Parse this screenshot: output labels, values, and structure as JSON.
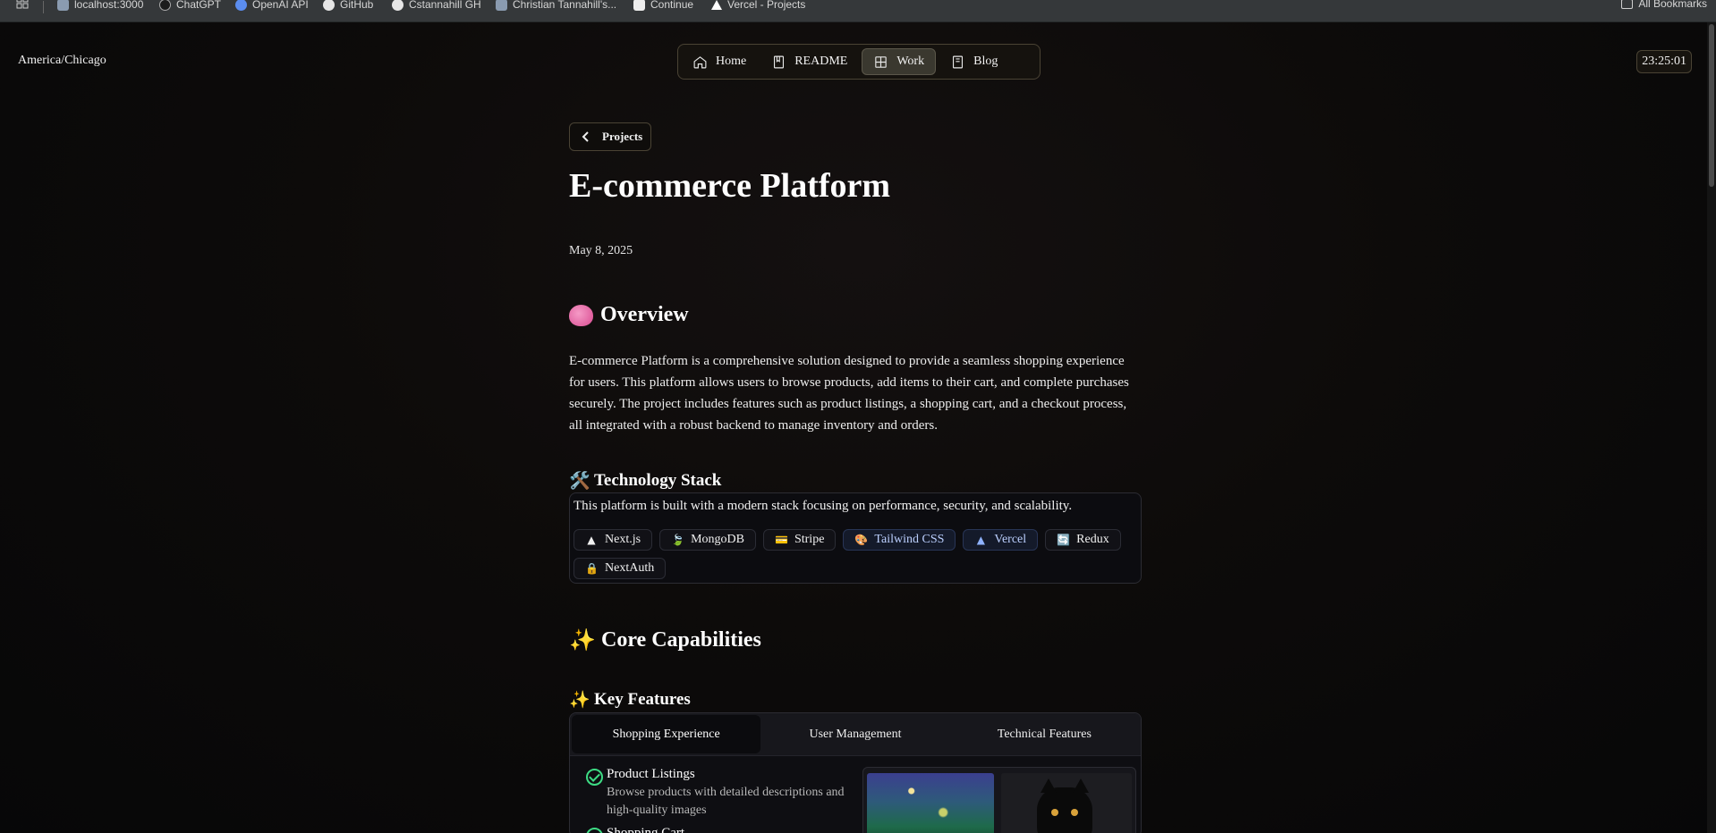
{
  "bookmarks": {
    "items": [
      {
        "label": "localhost:3000",
        "icon": "page-icon"
      },
      {
        "label": "ChatGPT",
        "icon": "openai-icon"
      },
      {
        "label": "OpenAI API",
        "icon": "openai-icon"
      },
      {
        "label": "GitHub",
        "icon": "github-icon"
      },
      {
        "label": "Cstannahill GH",
        "icon": "github-icon"
      },
      {
        "label": "Christian Tannahill's...",
        "icon": "page-icon"
      },
      {
        "label": "Continue",
        "icon": "continue-icon"
      },
      {
        "label": "Vercel - Projects",
        "icon": "vercel-icon"
      }
    ],
    "all_bookmarks": "All Bookmarks"
  },
  "header": {
    "timezone": "America/Chicago",
    "clock": "23:25:01",
    "nav": [
      {
        "label": "Home",
        "icon": "home-icon",
        "active": false
      },
      {
        "label": "README",
        "icon": "book-icon",
        "active": false
      },
      {
        "label": "Work",
        "icon": "grid-icon",
        "active": true
      },
      {
        "label": "Blog",
        "icon": "book-icon",
        "active": false
      }
    ]
  },
  "page": {
    "back_label": "Projects",
    "title": "E-commerce Platform",
    "date": "May 8, 2025",
    "overview": {
      "emoji": "🧠",
      "heading": "Overview",
      "text": "E-commerce Platform is a comprehensive solution designed to provide a seamless shopping experience for users. This platform allows users to browse products, add items to their cart, and complete purchases securely. The project includes features such as product listings, a shopping cart, and a checkout process, all integrated with a robust backend to manage inventory and orders."
    },
    "stack": {
      "emoji": "🛠️",
      "heading": "Technology Stack",
      "description": "This platform is built with a modern stack focusing on performance, security, and scalability.",
      "chips": [
        {
          "label": "Next.js",
          "icon": "▲",
          "style": "default"
        },
        {
          "label": "MongoDB",
          "icon": "🍃",
          "style": "default"
        },
        {
          "label": "Stripe",
          "icon": "💳",
          "style": "default"
        },
        {
          "label": "Tailwind CSS",
          "icon": "🎨",
          "style": "blue"
        },
        {
          "label": "Vercel",
          "icon": "▲",
          "style": "blue"
        },
        {
          "label": "Redux",
          "icon": "🔄",
          "style": "default"
        },
        {
          "label": "NextAuth",
          "icon": "🔒",
          "style": "default"
        }
      ]
    },
    "capabilities": {
      "emoji": "✨",
      "heading": "Core Capabilities"
    },
    "features": {
      "emoji": "✨",
      "heading": "Key Features",
      "tabs": [
        {
          "label": "Shopping Experience",
          "active": true
        },
        {
          "label": "User Management",
          "active": false
        },
        {
          "label": "Technical Features",
          "active": false
        }
      ],
      "items": [
        {
          "title": "Product Listings",
          "description": "Browse products with detailed descriptions and high-quality images"
        },
        {
          "title": "Shopping Cart",
          "description": ""
        }
      ]
    }
  },
  "colors": {
    "accent_border": "#4a4334",
    "check_green": "#3ddc84",
    "blue_chip": "#bcd0ff"
  }
}
